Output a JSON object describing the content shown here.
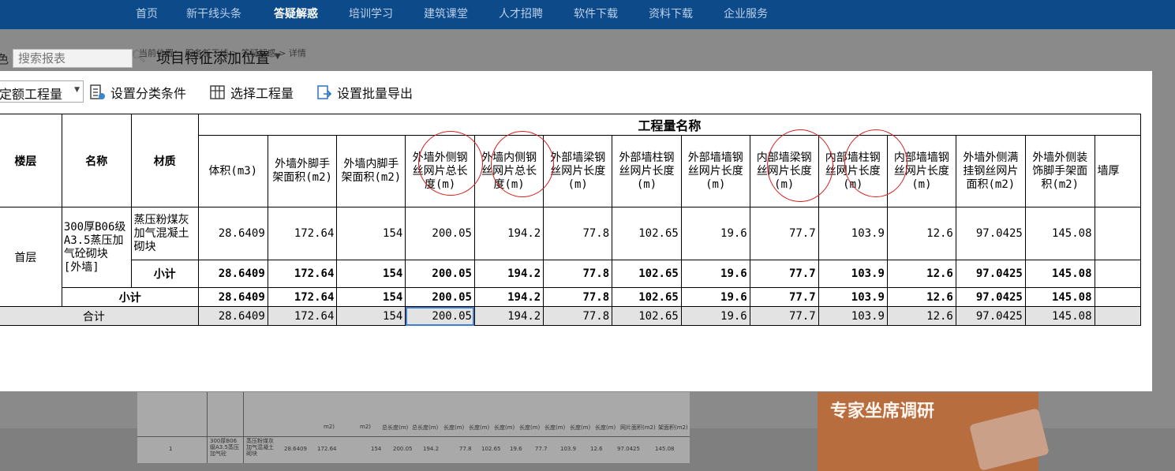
{
  "nav": {
    "items": [
      "首页",
      "新干线头条",
      "答疑解惑",
      "培训学习",
      "建筑课堂",
      "人才招聘",
      "软件下载",
      "资料下载",
      "企业服务"
    ],
    "active_index": 2
  },
  "background": {
    "breadcrumb": "当前位置： 服务新干线 > 答疑解惑 > 详情",
    "ad_title": "专家坐席调研",
    "thumb_headers": [
      "m2)",
      "m2)",
      "总长度(m)",
      "总长度(m)",
      "长度(m)",
      "长度(m)",
      "长度(m)",
      "长度(m)",
      "长度(m)",
      "长度(m)",
      "长度(m)",
      "网片面积(m2)",
      "架面积(m2)"
    ],
    "thumb_row": [
      "1",
      "300厚B06级A3.5蒸压加气砼",
      "蒸压粉煤灰加气混凝土砌块",
      "28.6409",
      "172.64",
      "154",
      "200.05",
      "194.2",
      "77.8",
      "102.65",
      "19.6",
      "77.7",
      "103.9",
      "12.6",
      "97.0425",
      "145.08"
    ]
  },
  "search": {
    "prefix": "色",
    "placeholder": "搜索报表",
    "position_label": "项目特征添加位置"
  },
  "toolbar": {
    "dropdown_label": "定额工程量",
    "set_category": "设置分类条件",
    "select_quantity": "选择工程量",
    "set_batch_export": "设置批量导出"
  },
  "table": {
    "group_header": "工程量名称",
    "fixed_headers": [
      "楼层",
      "名称",
      "材质"
    ],
    "columns": [
      "体积(m3)",
      "外墙外脚手架面积(m2)",
      "外墙内脚手架面积(m2)",
      "外墙外侧钢丝网片总长度(m)",
      "外墙内侧钢丝网片总长度(m)",
      "外部墙梁钢丝网片长度(m)",
      "外部墙柱钢丝网片长度(m)",
      "外部墙墙钢丝网片长度(m)",
      "内部墙梁钢丝网片长度(m)",
      "内部墙柱钢丝网片长度(m)",
      "内部墙墙钢丝网片长度(m)",
      "外墙外侧满挂钢丝网片面积(m2)",
      "外墙外侧装饰脚手架面积(m2)",
      "墙厚"
    ],
    "floor": "首层",
    "name": "300厚B06级A3.5蒸压加气砼砌块 [外墙]",
    "material": "蒸压粉煤灰加气混凝土砌块",
    "subtotal_label": "小计",
    "total_label": "合计",
    "values": [
      "28.6409",
      "172.64",
      "154",
      "200.05",
      "194.2",
      "77.8",
      "102.65",
      "19.6",
      "77.7",
      "103.9",
      "12.6",
      "97.0425",
      "145.08",
      ""
    ],
    "material_subtotal": [
      "28.6409",
      "172.64",
      "154",
      "200.05",
      "194.2",
      "77.8",
      "102.65",
      "19.6",
      "77.7",
      "103.9",
      "12.6",
      "97.0425",
      "145.08",
      ""
    ],
    "name_subtotal": [
      "28.6409",
      "172.64",
      "154",
      "200.05",
      "194.2",
      "77.8",
      "102.65",
      "19.6",
      "77.7",
      "103.9",
      "12.6",
      "97.0425",
      "145.08",
      ""
    ],
    "grand_total": [
      "28.6409",
      "172.64",
      "154",
      "200.05",
      "194.2",
      "77.8",
      "102.65",
      "19.6",
      "77.7",
      "103.9",
      "12.6",
      "97.0425",
      "145.08",
      ""
    ],
    "selected_cell": "grand_total.3",
    "circled_columns": [
      3,
      4,
      8,
      9
    ]
  },
  "colors": {
    "nav_bg": "#0d4a8a",
    "overlay_bg": "#7f7f7f",
    "annotation_red": "#d62020",
    "selection_blue": "#3f7fd0",
    "total_row_bg": "#e3e3e3"
  }
}
